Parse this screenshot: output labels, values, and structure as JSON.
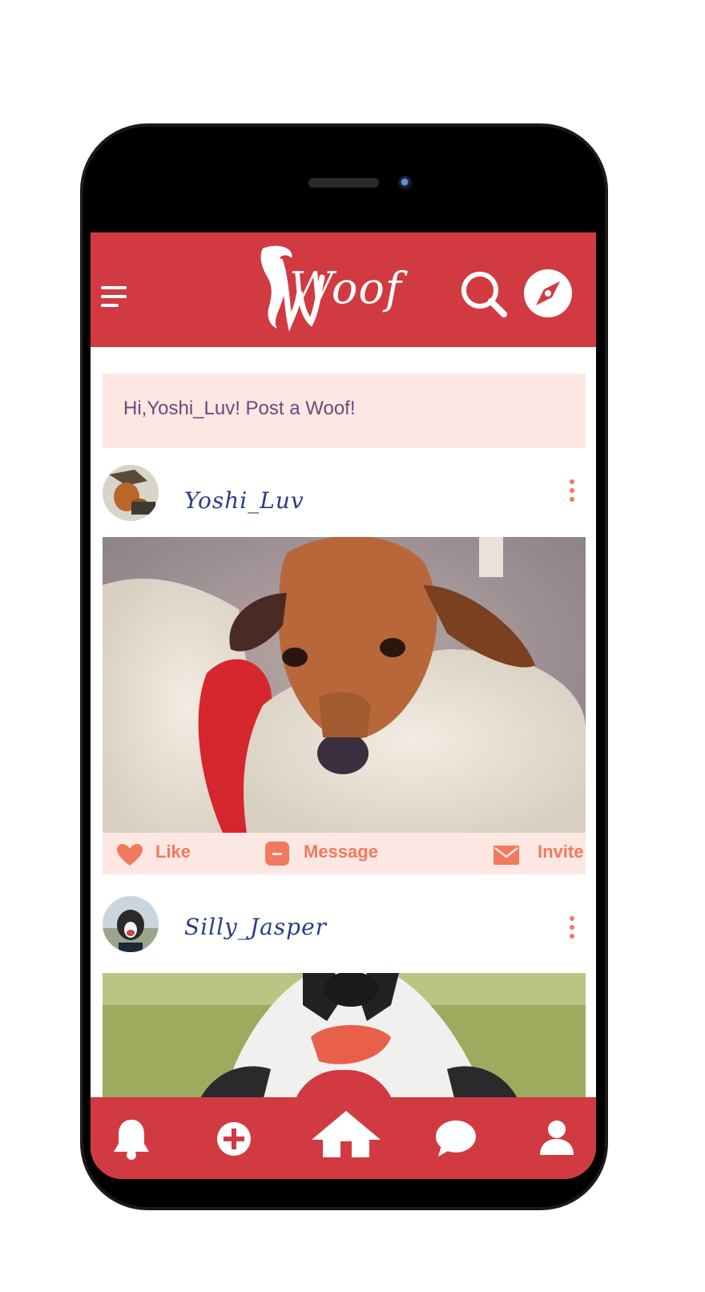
{
  "app": {
    "logo_text": "Woof",
    "brand_color": "#d13a40",
    "accent_color": "#f07a5e",
    "compose_bg": "#fce7e3"
  },
  "header": {
    "menu_icon": "hamburger-menu-icon",
    "search_icon": "search-icon",
    "explore_icon": "compass-icon"
  },
  "compose": {
    "prompt": "Hi,Yoshi_Luv! Post a Woof!"
  },
  "posts": [
    {
      "username": "Yoshi_Luv",
      "actions": {
        "like": "Like",
        "message": "Message",
        "invite": "Invite"
      }
    },
    {
      "username": "Silly_Jasper"
    }
  ],
  "bottom_nav": {
    "items": [
      {
        "icon": "bell-icon"
      },
      {
        "icon": "plus-circle-icon"
      },
      {
        "icon": "home-icon"
      },
      {
        "icon": "chat-bubble-icon"
      },
      {
        "icon": "profile-icon"
      }
    ]
  }
}
